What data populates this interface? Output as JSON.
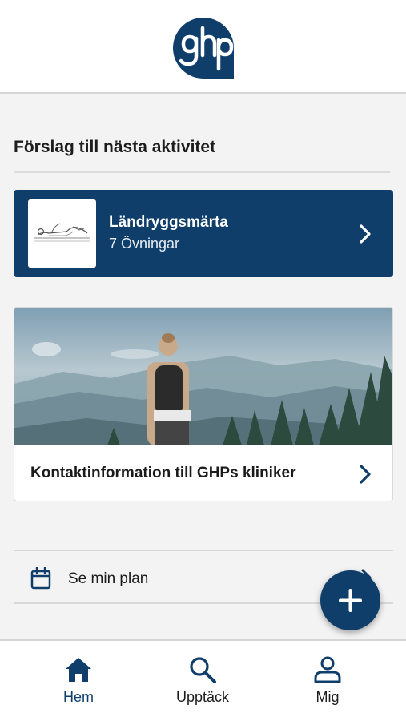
{
  "header": {
    "logo_text": "ghp"
  },
  "section": {
    "title": "Förslag till nästa aktivitet"
  },
  "program_card": {
    "title": "Ländryggsmärta",
    "subtitle": "7 Övningar",
    "thumb_icon": "exercise-illustration"
  },
  "info_card": {
    "title": "Kontaktinformation till GHPs kliniker",
    "image": "hiker-mountain-view"
  },
  "plan": {
    "label": "Se min plan",
    "icon": "calendar-icon"
  },
  "fab": {
    "icon": "plus-icon"
  },
  "tabs": [
    {
      "label": "Hem",
      "icon": "home-icon",
      "active": true
    },
    {
      "label": "Upptäck",
      "icon": "search-icon",
      "active": false
    },
    {
      "label": "Mig",
      "icon": "person-icon",
      "active": false
    }
  ],
  "colors": {
    "brand": "#0f3e6b",
    "background": "#f3f3f3",
    "card": "#ffffff"
  }
}
